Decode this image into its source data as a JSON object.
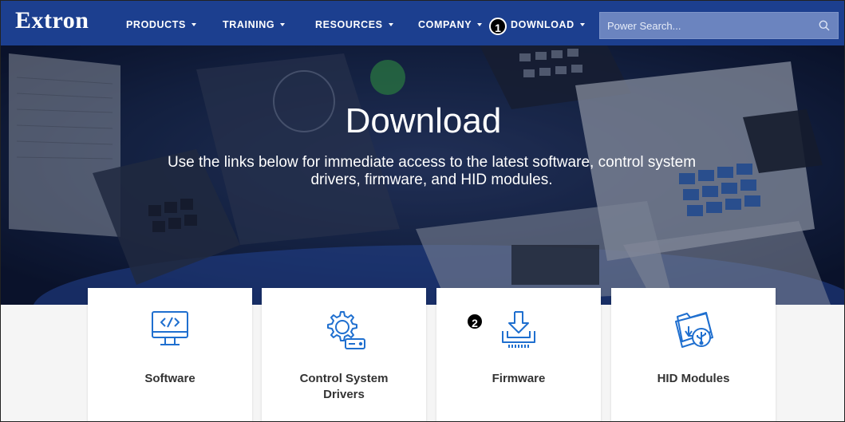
{
  "nav": {
    "logo": "Extron",
    "items": [
      {
        "label": "PRODUCTS"
      },
      {
        "label": "TRAINING"
      },
      {
        "label": "RESOURCES"
      },
      {
        "label": "COMPANY"
      },
      {
        "label": "DOWNLOAD"
      }
    ],
    "search_placeholder": "Power Search..."
  },
  "hero": {
    "title": "Download",
    "subtitle": "Use the links below for immediate access to the latest software, control system drivers, firmware, and HID modules."
  },
  "cards": [
    {
      "label": "Software",
      "icon": "monitor-code-icon"
    },
    {
      "label": "Control System Drivers",
      "icon": "gear-drive-icon"
    },
    {
      "label": "Firmware",
      "icon": "download-chip-icon"
    },
    {
      "label": "HID Modules",
      "icon": "folder-usb-icon"
    }
  ],
  "callouts": [
    "1",
    "2"
  ],
  "colors": {
    "nav": "#1c3f8f",
    "icon": "#1f6fcf",
    "search": "#6b84bf"
  }
}
